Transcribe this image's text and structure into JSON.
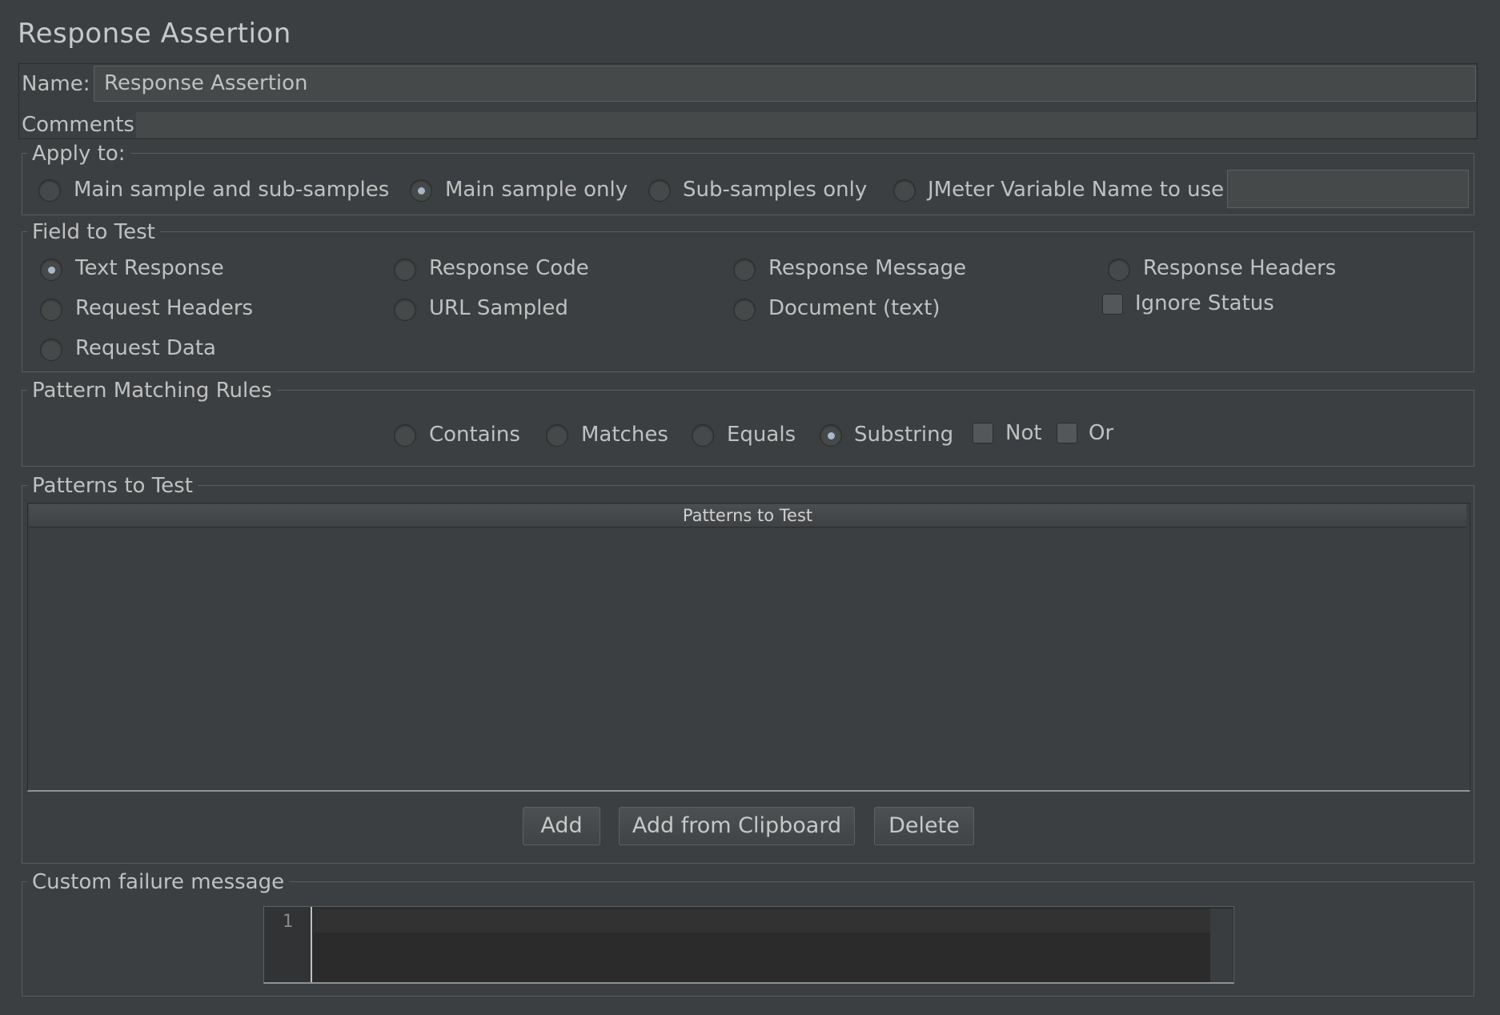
{
  "title": "Response Assertion",
  "name_label": "Name:",
  "name_value": "Response Assertion",
  "comments_label": "Comments:",
  "apply_to": {
    "legend": "Apply to:",
    "options": [
      "Main sample and sub-samples",
      "Main sample only",
      "Sub-samples only",
      "JMeter Variable Name to use"
    ],
    "selected": "Main sample only",
    "variable_value": ""
  },
  "field_to_test": {
    "legend": "Field to Test",
    "options": [
      "Text Response",
      "Response Code",
      "Response Message",
      "Response Headers",
      "Request Headers",
      "URL Sampled",
      "Document (text)",
      "Request Data"
    ],
    "selected": "Text Response",
    "ignore_status_label": "Ignore Status",
    "ignore_status_checked": false
  },
  "pattern_matching": {
    "legend": "Pattern Matching Rules",
    "options": [
      "Contains",
      "Matches",
      "Equals",
      "Substring"
    ],
    "selected": "Substring",
    "not_label": "Not",
    "not_checked": false,
    "or_label": "Or",
    "or_checked": false
  },
  "patterns": {
    "legend": "Patterns to Test",
    "column_header": "Patterns to Test",
    "rows": [],
    "buttons": {
      "add": "Add",
      "add_clipboard": "Add from Clipboard",
      "delete": "Delete"
    }
  },
  "custom_failure": {
    "legend": "Custom failure message",
    "line_number": "1",
    "value": ""
  }
}
